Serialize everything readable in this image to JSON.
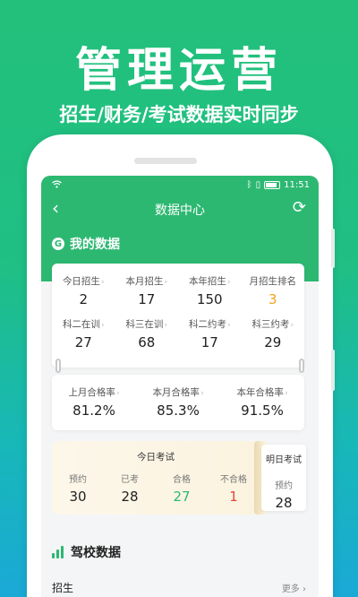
{
  "promo": {
    "title": "管理运营",
    "subtitle": "招生/财务/考试数据实时同步"
  },
  "status_bar": {
    "time": "11:51",
    "icons": [
      "wifi-icon",
      "bluetooth-icon",
      "vibrate-icon",
      "battery-icon"
    ]
  },
  "navbar": {
    "title": "数据中心"
  },
  "my_data": {
    "title": "我的数据"
  },
  "enrollment_stats": [
    {
      "label": "今日招生",
      "value": "2"
    },
    {
      "label": "本月招生",
      "value": "17"
    },
    {
      "label": "本年招生",
      "value": "150"
    },
    {
      "label": "月招生排名",
      "value": "3"
    }
  ],
  "training_stats": [
    {
      "label": "科二在训",
      "value": "27"
    },
    {
      "label": "科三在训",
      "value": "68"
    },
    {
      "label": "科二约考",
      "value": "17"
    },
    {
      "label": "科三约考",
      "value": "29"
    }
  ],
  "pass_rates": [
    {
      "label": "上月合格率",
      "value": "81.2%"
    },
    {
      "label": "本月合格率",
      "value": "85.3%"
    },
    {
      "label": "本年合格率",
      "value": "91.5%"
    }
  ],
  "exam_today": {
    "title": "今日考试",
    "stats": [
      {
        "label": "预约",
        "value": "30"
      },
      {
        "label": "已考",
        "value": "28"
      },
      {
        "label": "合格",
        "value": "27"
      },
      {
        "label": "不合格",
        "value": "1"
      }
    ]
  },
  "exam_tomorrow": {
    "title": "明日考试",
    "label": "预约",
    "value": "28"
  },
  "school_data": {
    "title": "驾校数据",
    "section_label": "招生",
    "more_label": "更多 ›"
  },
  "colors": {
    "brand_green": "#2db872",
    "rank_orange": "#f0a41a",
    "fail_red": "#e8453c"
  }
}
